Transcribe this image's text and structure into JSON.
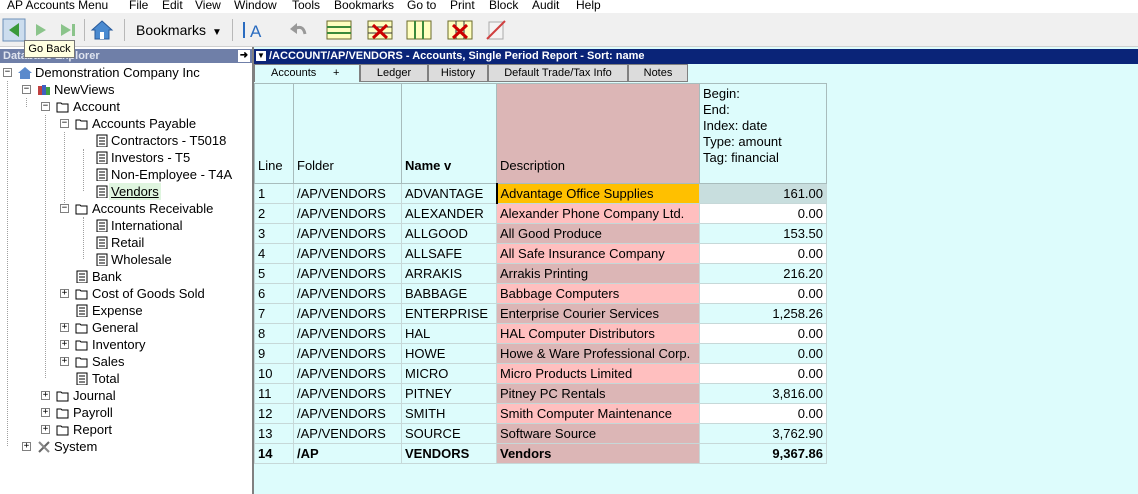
{
  "menu": [
    "AP Accounts Menu",
    "File",
    "Edit",
    "View",
    "Window",
    "Tools",
    "Bookmarks",
    "Go to",
    "Print",
    "Block",
    "Audit",
    "Help"
  ],
  "toolbar": {
    "bookmarks_label": "Bookmarks",
    "tooltip": "Go Back"
  },
  "sidebar": {
    "title": "Database Explorer",
    "items": [
      {
        "label": "Demonstration Company Inc"
      },
      {
        "label": "NewViews"
      },
      {
        "label": "Account"
      },
      {
        "label": "Accounts Payable"
      },
      {
        "label": "Contractors - T5018"
      },
      {
        "label": "Investors - T5"
      },
      {
        "label": "Non-Employee - T4A"
      },
      {
        "label": "Vendors"
      },
      {
        "label": "Accounts Receivable"
      },
      {
        "label": "International"
      },
      {
        "label": "Retail"
      },
      {
        "label": "Wholesale"
      },
      {
        "label": "Bank"
      },
      {
        "label": "Cost of Goods Sold"
      },
      {
        "label": "Expense"
      },
      {
        "label": "General"
      },
      {
        "label": "Inventory"
      },
      {
        "label": "Sales"
      },
      {
        "label": "Total"
      },
      {
        "label": "Journal"
      },
      {
        "label": "Payroll"
      },
      {
        "label": "Report"
      },
      {
        "label": "System"
      }
    ]
  },
  "main": {
    "title": "/ACCOUNT/AP/VENDORS - Accounts, Single Period Report - Sort: name",
    "tabs": [
      "Accounts",
      "+",
      "Ledger",
      "History",
      "Default Trade/Tax Info",
      "Notes"
    ],
    "headers": {
      "line": "Line",
      "folder": "Folder",
      "name": "Name  v",
      "description": "Description",
      "begin": "Begin:",
      "end": "End:",
      "index": "Index:  date",
      "type": "Type:   amount",
      "tag": "Tag:     financial"
    },
    "rows": [
      {
        "line": "1",
        "folder": "/AP/VENDORS",
        "name": "ADVANTAGE",
        "desc": "Advantage Office Supplies",
        "amount": "161.00"
      },
      {
        "line": "2",
        "folder": "/AP/VENDORS",
        "name": "ALEXANDER",
        "desc": "Alexander Phone Company Ltd.",
        "amount": "0.00"
      },
      {
        "line": "3",
        "folder": "/AP/VENDORS",
        "name": "ALLGOOD",
        "desc": "All Good Produce",
        "amount": "153.50"
      },
      {
        "line": "4",
        "folder": "/AP/VENDORS",
        "name": "ALLSAFE",
        "desc": "All Safe Insurance Company",
        "amount": "0.00"
      },
      {
        "line": "5",
        "folder": "/AP/VENDORS",
        "name": "ARRAKIS",
        "desc": "Arrakis Printing",
        "amount": "216.20"
      },
      {
        "line": "6",
        "folder": "/AP/VENDORS",
        "name": "BABBAGE",
        "desc": "Babbage Computers",
        "amount": "0.00"
      },
      {
        "line": "7",
        "folder": "/AP/VENDORS",
        "name": "ENTERPRISE",
        "desc": "Enterprise Courier Services",
        "amount": "1,258.26"
      },
      {
        "line": "8",
        "folder": "/AP/VENDORS",
        "name": "HAL",
        "desc": "HAL Computer Distributors",
        "amount": "0.00"
      },
      {
        "line": "9",
        "folder": "/AP/VENDORS",
        "name": "HOWE",
        "desc": "Howe & Ware Professional Corp.",
        "amount": "0.00"
      },
      {
        "line": "10",
        "folder": "/AP/VENDORS",
        "name": "MICRO",
        "desc": "Micro Products Limited",
        "amount": "0.00"
      },
      {
        "line": "11",
        "folder": "/AP/VENDORS",
        "name": "PITNEY",
        "desc": "Pitney PC Rentals",
        "amount": "3,816.00"
      },
      {
        "line": "12",
        "folder": "/AP/VENDORS",
        "name": "SMITH",
        "desc": "Smith Computer Maintenance",
        "amount": "0.00"
      },
      {
        "line": "13",
        "folder": "/AP/VENDORS",
        "name": "SOURCE",
        "desc": "Software Source",
        "amount": "3,762.90"
      },
      {
        "line": "14",
        "folder": "/AP",
        "name": "VENDORS",
        "desc": "Vendors",
        "amount": "9,367.86"
      }
    ]
  },
  "colors": {
    "title_bar": "#0a2478",
    "grid_bg": "#ddfcfc",
    "selected_cell": "#ffc000",
    "desc_pink": "#ffbfbf",
    "desc_rose": "#dcb6b6"
  }
}
